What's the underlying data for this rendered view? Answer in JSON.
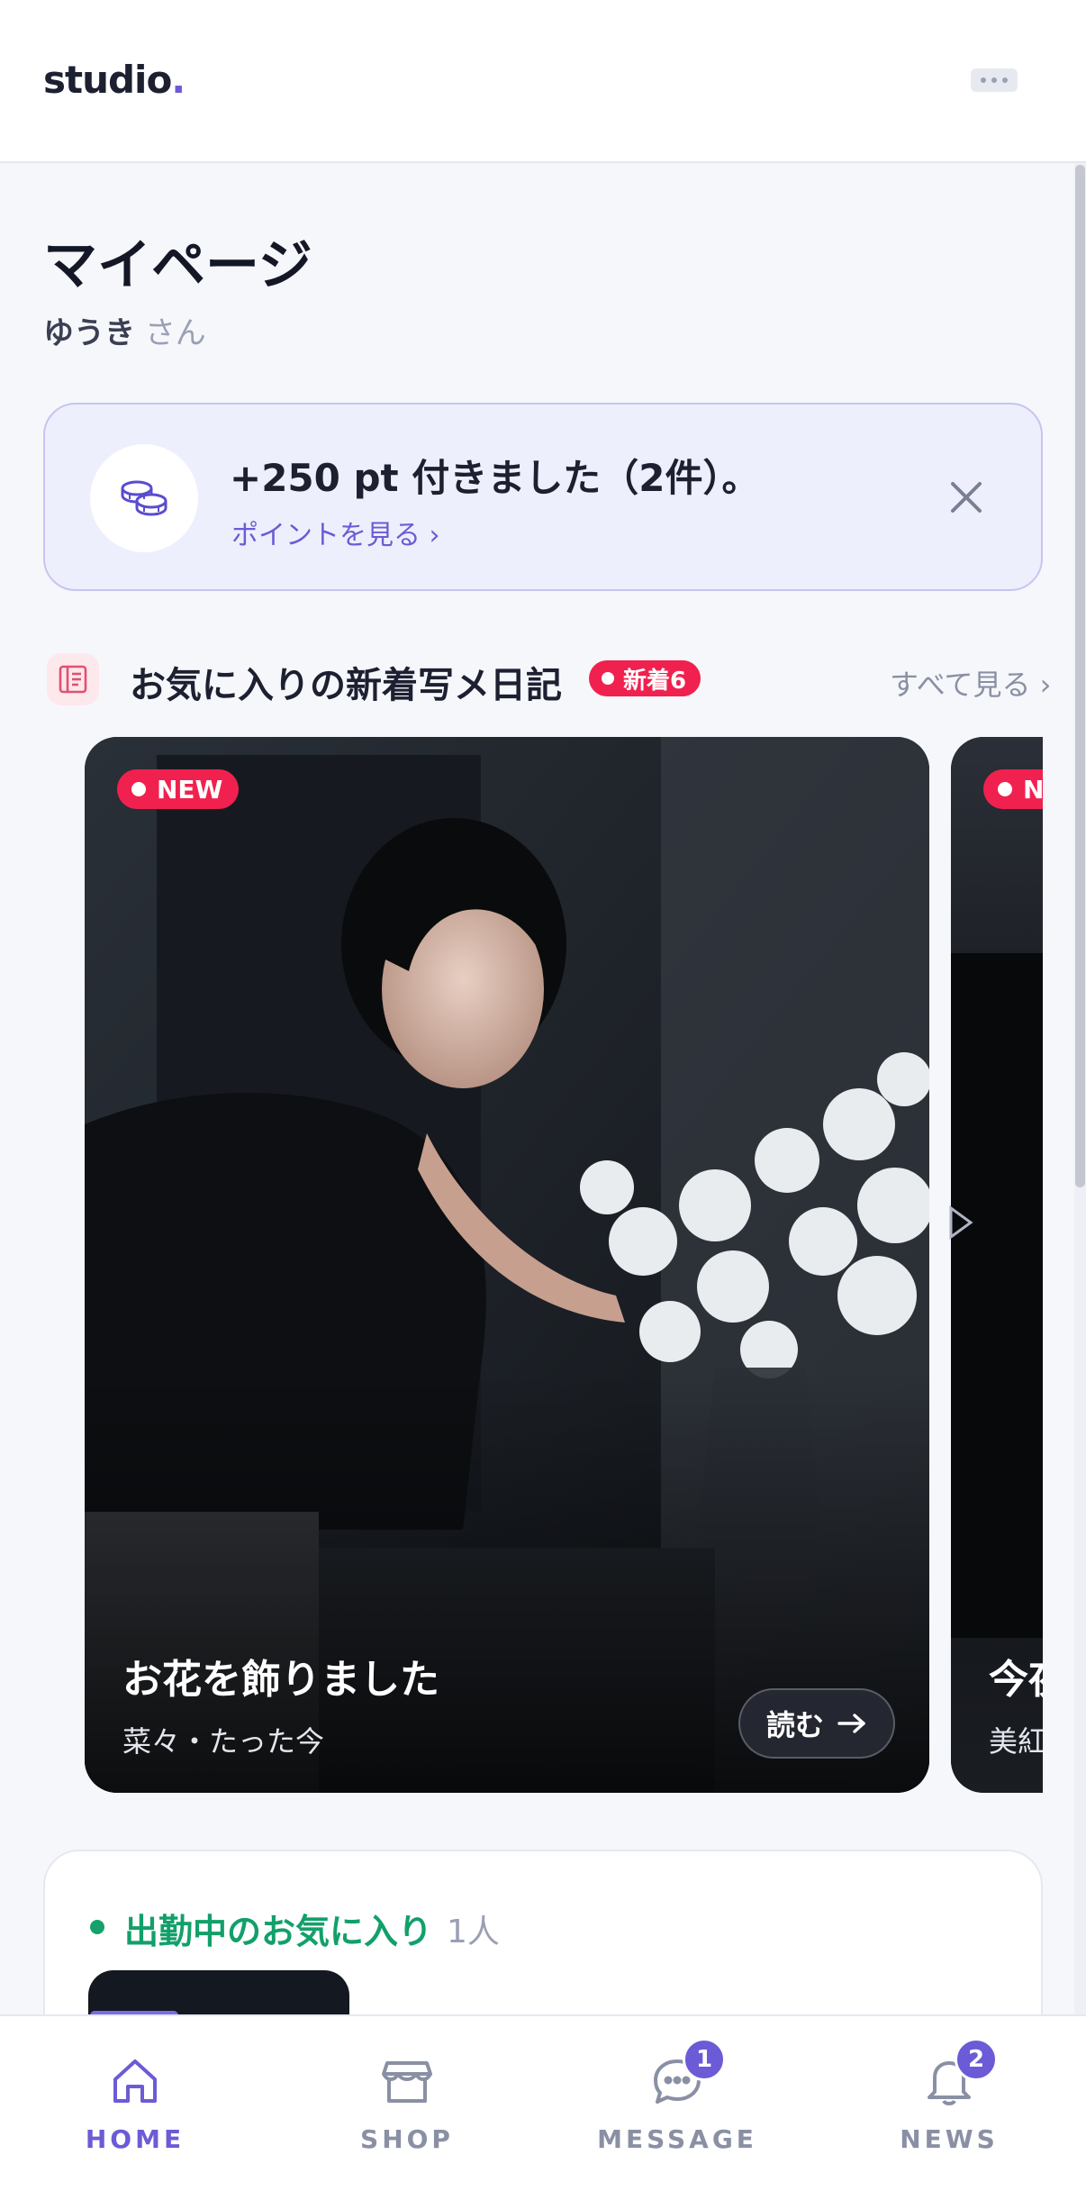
{
  "header": {
    "logo_text": "studio",
    "logo_dot": ".",
    "menu_icon": "more-dots-icon"
  },
  "page": {
    "title": "マイページ",
    "user_name": "ゆうき",
    "user_honorific": "さん"
  },
  "points_banner": {
    "icon": "coins-icon",
    "title": "+250 pt 付きました（2件）。",
    "link": "ポイントを見る ›",
    "close_icon": "close-icon"
  },
  "diary_section": {
    "icon": "diary-icon",
    "title": "お気に入りの新着写メ日記",
    "badge": "新着6",
    "see_all": "すべて見る ›",
    "cards": [
      {
        "badge": "NEW",
        "title": "お花を飾りました",
        "meta": "菜々・たった今",
        "read_label": "読む",
        "read_icon": "arrow-right-icon"
      },
      {
        "badge": "NEW",
        "title": "今夜",
        "meta": "美紅"
      }
    ],
    "next_icon": "chevron-right-icon"
  },
  "on_duty": {
    "title": "出勤中のお気に入り",
    "count": "1人"
  },
  "bottom_nav": {
    "items": [
      {
        "label": "HOME",
        "icon": "home-icon",
        "active": true
      },
      {
        "label": "SHOP",
        "icon": "shop-icon",
        "active": false
      },
      {
        "label": "MESSAGE",
        "icon": "message-icon",
        "badge": "1",
        "active": false
      },
      {
        "label": "NEWS",
        "icon": "bell-icon",
        "badge": "2",
        "active": false
      }
    ]
  },
  "colors": {
    "accent": "#6b5bd6",
    "new_badge": "#f0214f",
    "on_duty": "#12a06a"
  }
}
